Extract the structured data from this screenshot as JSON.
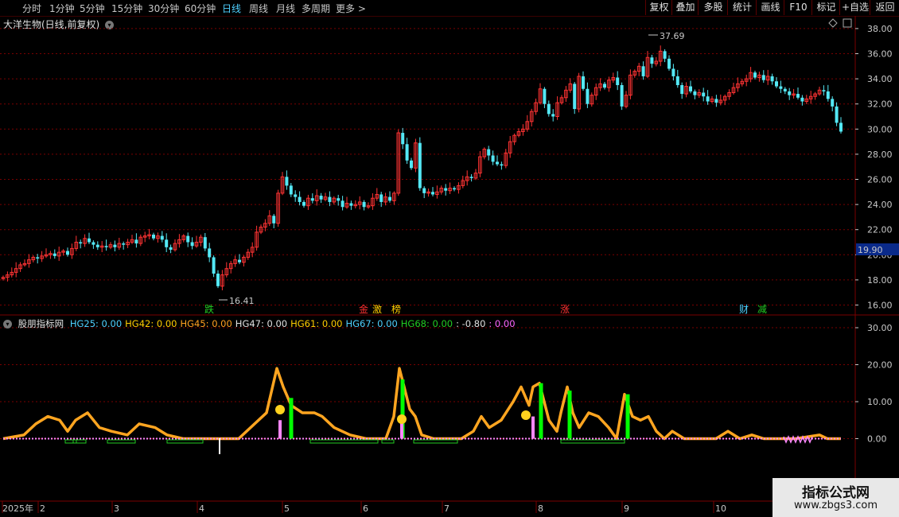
{
  "toolbar": {
    "timeframes": [
      "分时",
      "1分钟",
      "5分钟",
      "15分钟",
      "30分钟",
      "60分钟",
      "日线",
      "周线",
      "月线",
      "多周期",
      "更多 >"
    ],
    "active_timeframe": "日线",
    "right_buttons": [
      "复权",
      "叠加",
      "多股",
      "统计",
      "画线",
      "F10",
      "标记",
      "+自选",
      "返回"
    ]
  },
  "main_chart": {
    "title": "大洋生物(日线,前复权)",
    "high_label": "37.69",
    "low_label": "16.41",
    "current_price": "19.90",
    "y_ticks": [
      "38.00",
      "36.00",
      "34.00",
      "32.00",
      "30.00",
      "28.00",
      "26.00",
      "24.00",
      "22.00",
      "20.00",
      "18.00",
      "16.00"
    ],
    "events": [
      {
        "label": "跌",
        "color": "#22cc22"
      },
      {
        "label": "金",
        "color": "#ff3030"
      },
      {
        "label": "激",
        "color": "#ffcc00"
      },
      {
        "label": "榜",
        "color": "#ffcc00"
      },
      {
        "label": "涨",
        "color": "#ff3030"
      },
      {
        "label": "财",
        "color": "#4fd0ff"
      },
      {
        "label": "减",
        "color": "#22cc22"
      }
    ]
  },
  "indicator": {
    "name": "股朋指标网",
    "values": [
      {
        "text": "HG25: 0.00",
        "color": "#4fd0ff"
      },
      {
        "text": "HG42: 0.00",
        "color": "#ffcc00"
      },
      {
        "text": "HG45: 0.00",
        "color": "#ffa020"
      },
      {
        "text": "HG47: 0.00",
        "color": "#e0e0e0"
      },
      {
        "text": "HG61: 0.00",
        "color": "#ffcc00"
      },
      {
        "text": "HG67: 0.00",
        "color": "#4fd0ff"
      },
      {
        "text": "HG68: 0.00",
        "color": "#22cc22"
      },
      {
        "text": ": -0.80",
        "color": "#e0e0e0"
      },
      {
        "text": ": 0.00",
        "color": "#ff66ff"
      }
    ],
    "y_ticks": [
      "30.00",
      "20.00",
      "10.00",
      "0.00"
    ]
  },
  "time_axis": {
    "labels": [
      "2025年",
      "2",
      "3",
      "4",
      "5",
      "6",
      "7",
      "8",
      "9",
      "10"
    ]
  },
  "watermark": {
    "line1": "指标公式网",
    "line2": "www.zbgs3.com"
  },
  "colors": {
    "up": "#ff3333",
    "down": "#54e8f5",
    "line": "#ffa520",
    "bar_green": "#00ff00",
    "bar_pink": "#ff88ff",
    "grid": "#7a0000"
  },
  "chart_data": {
    "type": "candlestick",
    "ylim": [
      15.5,
      38.7
    ],
    "closes": [
      18.2,
      18.4,
      18.6,
      18.9,
      19.2,
      19.3,
      19.6,
      19.8,
      19.7,
      19.9,
      20.0,
      20.1,
      19.9,
      20.2,
      20.3,
      20.0,
      20.5,
      21.0,
      20.9,
      21.3,
      21.0,
      20.8,
      20.6,
      20.7,
      20.6,
      20.8,
      20.6,
      20.9,
      20.8,
      21.0,
      21.2,
      20.9,
      21.4,
      21.5,
      21.6,
      21.3,
      21.5,
      21.2,
      20.6,
      20.4,
      20.9,
      21.2,
      21.5,
      21.0,
      20.7,
      21.0,
      21.4,
      20.5,
      19.8,
      18.5,
      17.5,
      18.4,
      18.9,
      19.3,
      19.6,
      19.4,
      19.8,
      20.2,
      20.6,
      21.8,
      22.2,
      22.5,
      23.1,
      22.5,
      24.9,
      26.2,
      25.5,
      24.8,
      24.6,
      24.2,
      23.9,
      24.5,
      24.3,
      24.7,
      24.4,
      24.6,
      24.2,
      24.5,
      24.3,
      23.8,
      24.1,
      23.9,
      24.0,
      24.2,
      23.8,
      23.9,
      24.5,
      24.8,
      24.2,
      24.6,
      24.3,
      24.9,
      29.7,
      28.8,
      27.5,
      26.9,
      28.9,
      25.3,
      24.9,
      25.0,
      24.8,
      25.0,
      25.3,
      25.1,
      25.3,
      25.2,
      25.5,
      25.9,
      26.2,
      26.1,
      26.5,
      27.8,
      28.4,
      27.9,
      27.4,
      27.2,
      27.1,
      28.1,
      29.0,
      29.5,
      29.8,
      30.0,
      30.6,
      31.4,
      32.1,
      33.2,
      32.0,
      31.2,
      31.0,
      32.1,
      32.5,
      33.1,
      33.6,
      31.6,
      34.2,
      33.2,
      32.0,
      32.7,
      33.3,
      33.6,
      33.3,
      33.9,
      34.1,
      33.5,
      31.8,
      32.7,
      34.3,
      34.6,
      35.0,
      34.2,
      35.7,
      35.2,
      35.4,
      36.2,
      35.6,
      34.8,
      34.2,
      33.5,
      32.8,
      33.4,
      33.0,
      32.7,
      32.9,
      32.6,
      32.2,
      32.4,
      32.1,
      32.3,
      32.6,
      32.9,
      33.3,
      33.6,
      33.8,
      34.0,
      34.5,
      34.1,
      34.3,
      33.9,
      34.2,
      33.8,
      33.4,
      33.2,
      33.0,
      32.7,
      32.8,
      32.5,
      32.2,
      32.4,
      32.6,
      32.8,
      33.1,
      33.0,
      32.4,
      31.8,
      30.5,
      29.8
    ]
  }
}
